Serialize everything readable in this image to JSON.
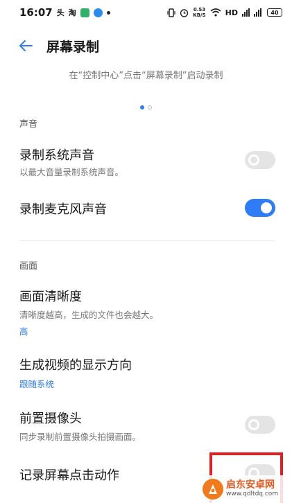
{
  "status_bar": {
    "time": "16:07",
    "app_icon_1": "头",
    "app_icon_2": "淘",
    "net_speed": "0.53",
    "net_speed_unit": "KB/S",
    "hd_label": "HD",
    "battery": "40",
    "icons": [
      "vibrate-icon",
      "alarm-icon",
      "wifi-icon",
      "signal-icon"
    ]
  },
  "header": {
    "title": "屏幕录制"
  },
  "hint_text": "在“控制中心”点击“屏幕录制”启动录制",
  "sections": {
    "sound": {
      "title": "声音",
      "system_sound": {
        "label": "录制系统声音",
        "desc": "以最大音量录制系统声音。",
        "enabled": false
      },
      "mic_sound": {
        "label": "录制麦克风声音",
        "enabled": true
      }
    },
    "picture": {
      "title": "画面",
      "resolution": {
        "label": "画面清晰度",
        "desc": "清晰度越高，生成的文件也会越大。",
        "value": "高"
      },
      "orientation": {
        "label": "生成视频的显示方向",
        "value": "跟随系统"
      },
      "front_camera": {
        "label": "前置摄像头",
        "desc": "同步录制前置摄像头拍摄画面。",
        "enabled": false
      },
      "touch_record": {
        "label": "记录屏幕点击动作",
        "enabled": false
      }
    }
  },
  "colors": {
    "accent": "#2f7df6",
    "highlight": "#e02020"
  },
  "watermark": {
    "name": "启东安卓网",
    "url": "www.qdltdq.com"
  }
}
